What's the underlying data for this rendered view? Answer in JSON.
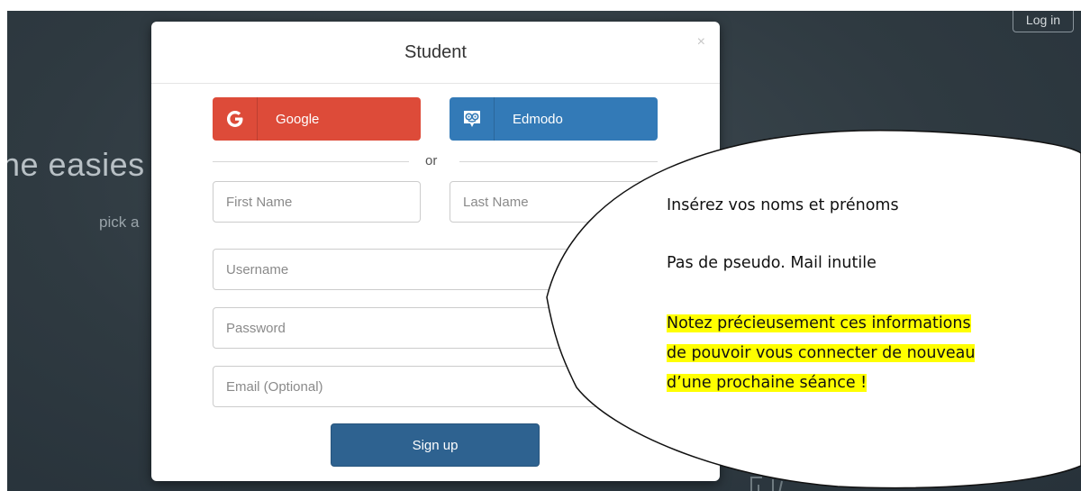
{
  "header": {
    "login_label": "Log in"
  },
  "hero": {
    "title": "he easies",
    "subtitle": "pick a"
  },
  "modal": {
    "title": "Student",
    "close_label": "×",
    "google_label": "Google",
    "edmodo_label": "Edmodo",
    "divider_text": "or",
    "fields": {
      "first_name_placeholder": "First Name",
      "last_name_placeholder": "Last Name",
      "username_placeholder": "Username",
      "password_placeholder": "Password",
      "email_placeholder": "Email (Optional)"
    },
    "signup_label": "Sign up"
  },
  "callout": {
    "line1": "Insérez vos noms et prénoms",
    "line2": "Pas de pseudo. Mail inutile",
    "highlight_lines": [
      "Notez précieusement ces informations",
      "de pouvoir vous connecter de nouveau",
      "d’une prochaine séance !"
    ],
    "highlight_color": "#ffff00"
  },
  "colors": {
    "google": "#dd4b39",
    "edmodo": "#337ab7",
    "signup": "#2e6290",
    "background": "#2f3a41"
  },
  "icons": {
    "google": "google-g-icon",
    "edmodo": "edmodo-owl-icon",
    "close": "close-icon"
  }
}
